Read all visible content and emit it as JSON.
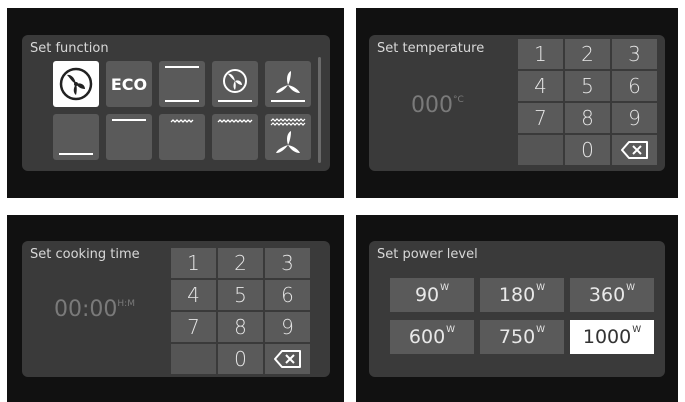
{
  "colors": {
    "screen": "#111111",
    "panel": "#3a3a3a",
    "button": "#5a5a5a",
    "active": "#ffffff"
  },
  "function_panel": {
    "title": "Set function",
    "eco_label": "ECO",
    "buttons": [
      {
        "icon": "fan-icon",
        "active": true
      },
      {
        "icon": "eco-text",
        "active": false
      },
      {
        "icon": "top-bottom-heat-icon",
        "active": false
      },
      {
        "icon": "fan-bottom-heat-icon",
        "active": false
      },
      {
        "icon": "fan-grill-icon",
        "active": false
      },
      {
        "icon": "bottom-heat-icon",
        "active": false
      },
      {
        "icon": "top-heat-icon",
        "active": false
      },
      {
        "icon": "grill-icon",
        "active": false
      },
      {
        "icon": "double-grill-icon",
        "active": false
      },
      {
        "icon": "grill-fan-icon",
        "active": false
      }
    ]
  },
  "temperature_panel": {
    "title": "Set temperature",
    "value": "000",
    "unit": "°C",
    "keys": [
      "1",
      "2",
      "3",
      "4",
      "5",
      "6",
      "7",
      "8",
      "9",
      "",
      "0",
      "backspace"
    ]
  },
  "time_panel": {
    "title": "Set cooking time",
    "value": "00:00",
    "unit": "H:M",
    "keys": [
      "1",
      "2",
      "3",
      "4",
      "5",
      "6",
      "7",
      "8",
      "9",
      "",
      "0",
      "backspace"
    ]
  },
  "power_panel": {
    "title": "Set power level",
    "unit": "W",
    "levels": [
      {
        "value": "90",
        "selected": false
      },
      {
        "value": "180",
        "selected": false
      },
      {
        "value": "360",
        "selected": false
      },
      {
        "value": "600",
        "selected": false
      },
      {
        "value": "750",
        "selected": false
      },
      {
        "value": "1000",
        "selected": true
      }
    ]
  }
}
